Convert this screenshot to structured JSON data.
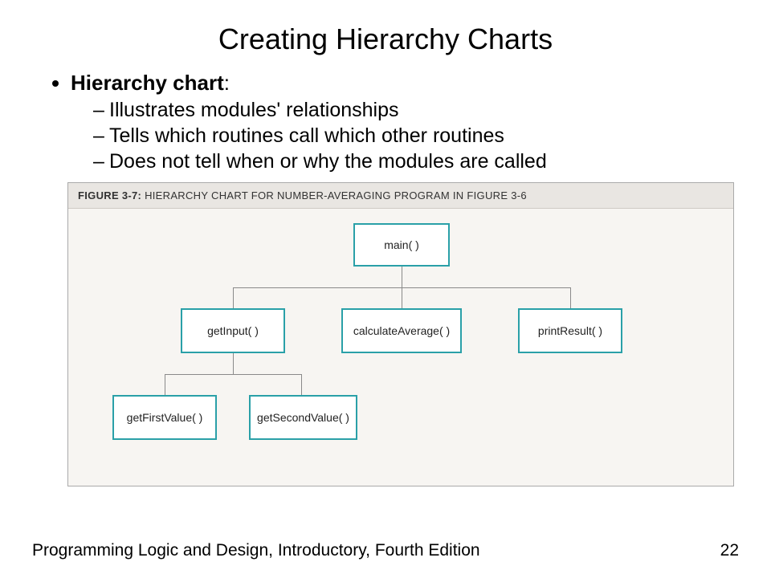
{
  "title": "Creating Hierarchy Charts",
  "lead": {
    "label": "Hierarchy chart",
    "colon": ":"
  },
  "bullets": [
    "Illustrates modules' relationships",
    "Tells which routines call which other routines",
    "Does not tell when or why the modules are called"
  ],
  "figure": {
    "label": "FIGURE 3-7:",
    "caption": "HIERARCHY CHART FOR NUMBER-AVERAGING PROGRAM IN FIGURE 3-6"
  },
  "chart_data": {
    "type": "hierarchy",
    "root": "main( )",
    "children": [
      {
        "name": "getInput( )",
        "children": [
          {
            "name": "getFirstValue( )"
          },
          {
            "name": "getSecondValue( )"
          }
        ]
      },
      {
        "name": "calculateAverage( )"
      },
      {
        "name": "printResult( )"
      }
    ]
  },
  "footer": {
    "left": "Programming Logic and Design, Introductory, Fourth Edition",
    "right": "22"
  }
}
